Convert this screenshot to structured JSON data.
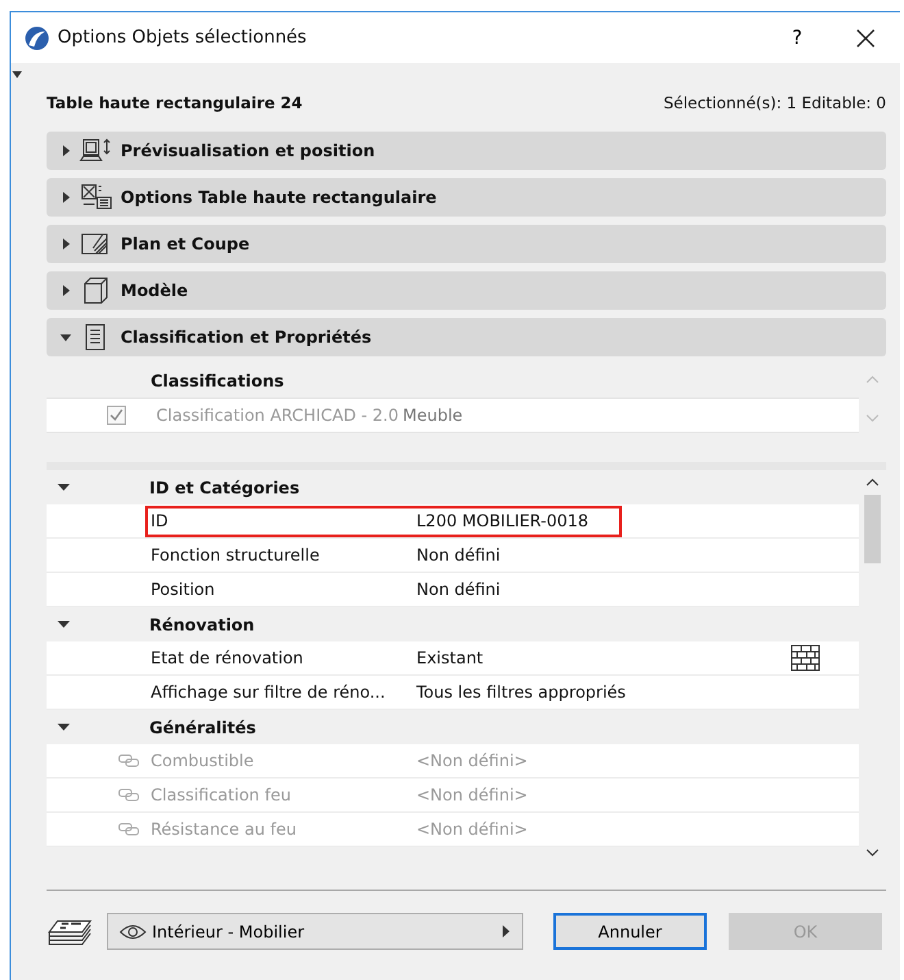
{
  "window": {
    "title": "Options Objets sélectionnés",
    "help": "?"
  },
  "header": {
    "element": "Table haute rectangulaire 24",
    "selection": "Sélectionné(s): 1 Editable: 0"
  },
  "panels": [
    {
      "label": "Prévisualisation et position",
      "expanded": false
    },
    {
      "label": "Options Table haute rectangulaire",
      "expanded": false
    },
    {
      "label": "Plan et Coupe",
      "expanded": false
    },
    {
      "label": "Modèle",
      "expanded": false
    },
    {
      "label": "Classification et Propriétés",
      "expanded": true
    }
  ],
  "classifications": {
    "heading": "Classifications",
    "rows": [
      {
        "system": "Classification ARCHICAD - 2.0",
        "value": "Meuble",
        "checked": true
      }
    ]
  },
  "properties": [
    {
      "group": "ID et Catégories",
      "expanded": true,
      "rows": [
        {
          "kind": "text",
          "name": "ID",
          "value": "L200 MOBILIER-0018",
          "highlighted": true
        },
        {
          "kind": "text",
          "name": "Fonction structurelle",
          "value": "Non défini",
          "highlighted": false
        },
        {
          "kind": "text",
          "name": "Position",
          "value": "Non défini",
          "highlighted": false
        }
      ]
    },
    {
      "group": "Rénovation",
      "expanded": true,
      "rows": [
        {
          "kind": "renovation",
          "name": "Etat de rénovation",
          "value": "Existant",
          "highlighted": false
        },
        {
          "kind": "text",
          "name": "Affichage sur filtre de réno...",
          "value": "Tous les filtres appropriés",
          "highlighted": false
        }
      ]
    },
    {
      "group": "Généralités",
      "expanded": true,
      "rows": [
        {
          "kind": "linked",
          "name": "Combustible",
          "value": "<Non défini>",
          "highlighted": false
        },
        {
          "kind": "linked",
          "name": "Classification feu",
          "value": "<Non défini>",
          "highlighted": false
        },
        {
          "kind": "linked",
          "name": "Résistance au feu",
          "value": "<Non défini>",
          "highlighted": false
        }
      ]
    }
  ],
  "footer": {
    "layer": "Intérieur - Mobilier",
    "cancel": "Annuler",
    "ok": "OK",
    "ok_disabled": true
  }
}
